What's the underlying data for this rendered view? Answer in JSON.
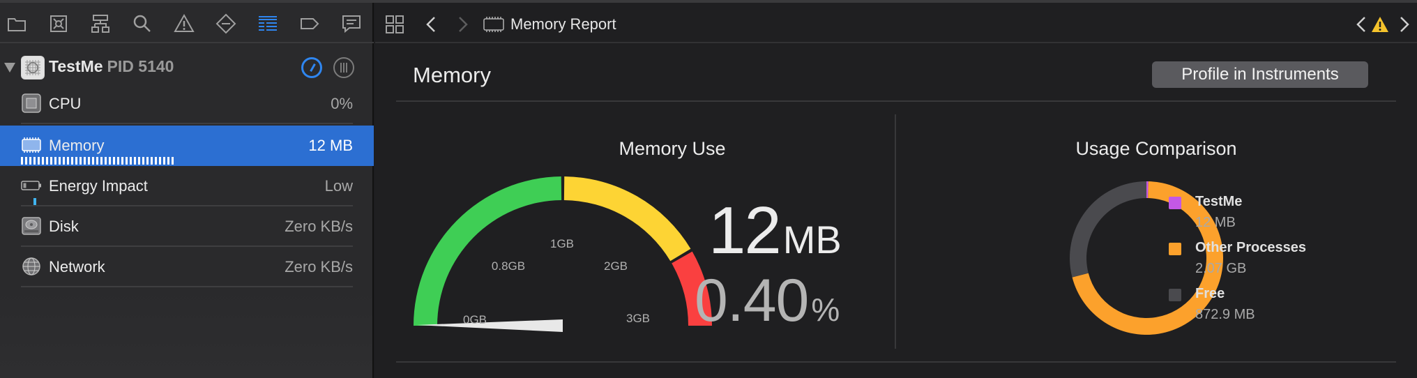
{
  "sidebar": {
    "process": {
      "name": "TestMe",
      "pid": "PID 5140"
    },
    "gauges": [
      {
        "label": "CPU",
        "value": "0%"
      },
      {
        "label": "Memory",
        "value": "12 MB"
      },
      {
        "label": "Energy Impact",
        "value": "Low"
      },
      {
        "label": "Disk",
        "value": "Zero KB/s"
      },
      {
        "label": "Network",
        "value": "Zero KB/s"
      }
    ]
  },
  "jumpbar": {
    "title": "Memory Report"
  },
  "report": {
    "title": "Memory",
    "profile_button": "Profile in Instruments",
    "memory_use": {
      "title": "Memory Use",
      "value": "12",
      "unit": "MB",
      "percent": "0.40",
      "percent_unit": "%",
      "tick_labels": [
        "0GB",
        "0.8GB",
        "1GB",
        "2GB",
        "3GB"
      ],
      "segment_colors": [
        "#3fce55",
        "#fdd434",
        "#fa4040"
      ]
    },
    "usage_comparison": {
      "title": "Usage Comparison",
      "legend": [
        {
          "name": "TestMe",
          "value": "12 MB",
          "color": "#c358e6"
        },
        {
          "name": "Other Processes",
          "value": "2.07 GB",
          "color": "#fca12c"
        },
        {
          "name": "Free",
          "value": "872.9 MB",
          "color": "#4a4a4e"
        }
      ]
    }
  },
  "chart_data": {
    "type": "pie",
    "title": "Usage Comparison",
    "categories": [
      "TestMe",
      "Other Processes",
      "Free"
    ],
    "values": [
      12,
      2120,
      872.9
    ],
    "unit": "MB",
    "donut": true,
    "legend_position": "right"
  },
  "colors": {
    "accent": "#2c6fd2",
    "background": "#1f1f21",
    "sidebar": "#2a2a2c"
  }
}
